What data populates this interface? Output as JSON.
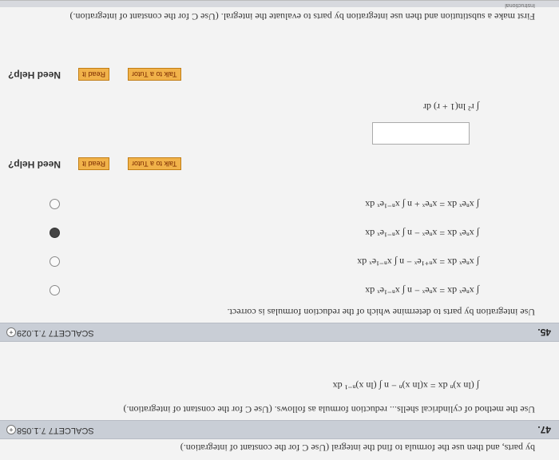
{
  "top_partial": {
    "text": "by parts, and then use the formula to find the integral (Use C for the constant of integration.)"
  },
  "q47": {
    "number": "47.",
    "reference": "SCALCET7 7.1.058.",
    "plus": "+",
    "intro": "Use the method of cylindrical shells... reduction formula as follows. (Use C for the constant of integration.)",
    "formula": "∫ (ln x)ⁿ dx = x(ln x)ⁿ − n ∫ (ln x)ⁿ⁻¹ dx"
  },
  "q45": {
    "number": "45.",
    "reference": "SCALCET7 7.1.029.",
    "plus": "+",
    "intro": "Use integration by parts to determine which of the reduction formulas is correct.",
    "options": [
      "∫ xⁿeˣ dx = xⁿeˣ − n ∫ xⁿ⁻¹eˣ dx",
      "∫ xⁿeˣ dx = xⁿ⁺¹eˣ − n ∫ xⁿ⁻¹eˣ dx",
      "∫ xⁿeˣ dx = xⁿeˣ − n ∫ xⁿ⁻¹eˣ dx",
      "∫ xⁿeˣ dx = xⁿeˣ + n ∫ xⁿ⁻¹eˣ dx"
    ],
    "selected_index": 2
  },
  "q_first": {
    "intro": "First make a substitution and then use integration by parts to evaluate the integral. (Use C for the constant of integration.)",
    "integral": "∫ r² ln(1 + r) dr",
    "answer_value": ""
  },
  "help": {
    "label": "Need Help?",
    "read_it": "Read It",
    "talk_to_tutor": "Talk to a Tutor"
  },
  "footer_banner": "Instructional"
}
